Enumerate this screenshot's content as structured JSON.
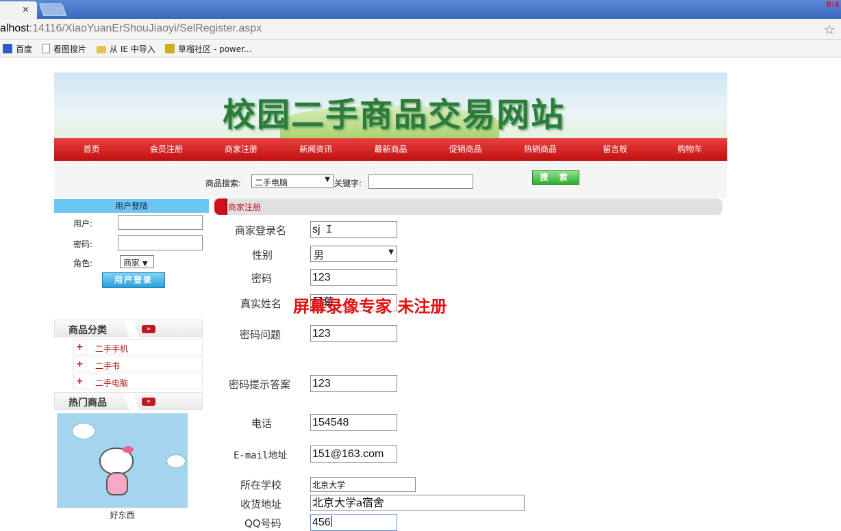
{
  "browser": {
    "url_host": "alhost",
    "url_rest": ":14116/XiaoYuanErShouJiaoyi/SelRegister.aspx",
    "tab_close": "×",
    "win_ctrl": "0:4",
    "bookmarks": [
      "百度",
      "看图搜片",
      "从 IE 中导入",
      "草榴社区 - power..."
    ]
  },
  "site": {
    "banner_title": "校园二手商品交易网站",
    "nav": [
      "首页",
      "会员注册",
      "商家注册",
      "新闻资讯",
      "最新商品",
      "促销商品",
      "热销商品",
      "留言板",
      "购物车"
    ]
  },
  "search": {
    "label": "商品搜索:",
    "category_value": "二手电脑",
    "keyword_label": "关键字:",
    "keyword_value": "",
    "button_label": "搜 索"
  },
  "login": {
    "title": "用户登陆",
    "user_label": "用户:",
    "password_label": "密码:",
    "role_label": "角色:",
    "role_value": "商家",
    "button_label": "用户登录"
  },
  "categories": {
    "title": "商品分类",
    "more": "»",
    "items": [
      "二手手机",
      "二手书",
      "二手电脑"
    ]
  },
  "hot": {
    "title": "热门商品",
    "more": "»",
    "caption": "好东西"
  },
  "form": {
    "section_title": "商家注册",
    "fields": {
      "login_name": {
        "label": "商家登录名",
        "value": "sj"
      },
      "gender": {
        "label": "性别",
        "value": "男"
      },
      "password": {
        "label": "密码",
        "value": "123"
      },
      "real_name": {
        "label": "真实姓名",
        "value": "屏幕"
      },
      "question": {
        "label": "密码问题",
        "value": "123"
      },
      "answer": {
        "label": "密码提示答案",
        "value": "123"
      },
      "phone": {
        "label": "电话",
        "value": "154548"
      },
      "email": {
        "label": "E-mail地址",
        "value": "151@163.com"
      },
      "school": {
        "label": "所在学校",
        "value": "北京大学"
      },
      "address": {
        "label": "收货地址",
        "value": "北京大学a宿舍"
      },
      "qq": {
        "label": "QQ号码",
        "value": "456"
      }
    },
    "watermark": "屏幕录像专家  未注册"
  }
}
